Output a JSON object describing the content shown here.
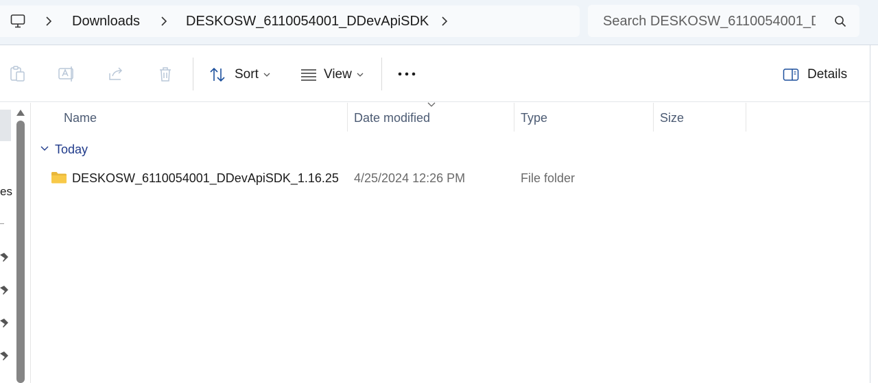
{
  "address_bar": {
    "breadcrumbs": [
      "Downloads",
      "DESKOSW_6110054001_DDevApiSDK"
    ]
  },
  "search": {
    "placeholder": "Search DESKOSW_6110054001_D"
  },
  "toolbar": {
    "sort_label": "Sort",
    "view_label": "View",
    "more_label": "•••",
    "details_label": "Details"
  },
  "nav": {
    "partial_item_text": "es"
  },
  "columns": {
    "name": "Name",
    "date_modified": "Date modified",
    "type": "Type",
    "size": "Size"
  },
  "groups": [
    {
      "label": "Today",
      "items": [
        {
          "name": "DESKOSW_6110054001_DDevApiSDK_1.16.25",
          "date_modified": "4/25/2024 12:26 PM",
          "type": "File folder",
          "size": ""
        }
      ]
    }
  ],
  "colors": {
    "accent": "#005fb8",
    "group_label": "#1f3a8a",
    "header_text": "#4c5b73",
    "folder": "#f8c948"
  }
}
